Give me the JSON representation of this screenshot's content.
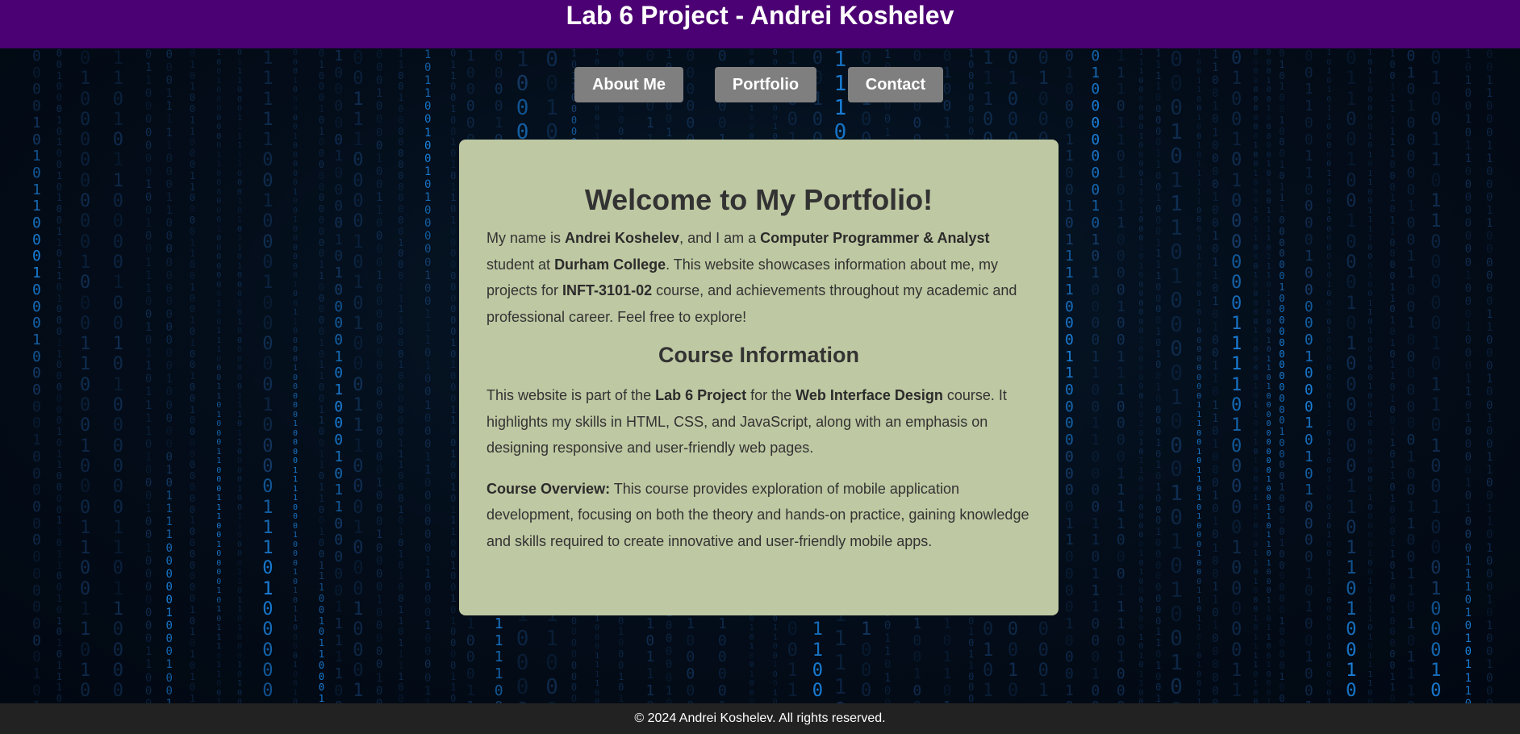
{
  "header": {
    "title": "Lab 6 Project - Andrei Koshelev"
  },
  "nav": {
    "items": [
      {
        "label": "About Me"
      },
      {
        "label": "Portfolio"
      },
      {
        "label": "Contact"
      }
    ]
  },
  "main": {
    "welcome_title": "Welcome to My Portfolio!",
    "intro": {
      "t1": "My name is ",
      "b1": "Andrei Koshelev",
      "t2": ", and I am a ",
      "b2": "Computer Programmer & Analyst",
      "t3": " student at ",
      "b3": "Durham College",
      "t4": ". This website showcases information about me, my projects for ",
      "b4": "INFT-3101-02",
      "t5": " course, and achievements throughout my academic and professional career. Feel free to explore!"
    },
    "course_title": "Course Information",
    "course_info": {
      "t1": "This website is part of the ",
      "b1": "Lab 6 Project",
      "t2": " for the ",
      "b2": "Web Interface Design",
      "t3": " course. It highlights my skills in HTML, CSS, and JavaScript, along with an emphasis on designing responsive and user-friendly web pages."
    },
    "course_overview": {
      "label": "Course Overview:",
      "text": " This course provides exploration of mobile application development, focusing on both the theory and hands-on practice, gaining knowledge and skills required to create innovative and user-friendly mobile apps."
    }
  },
  "footer": {
    "text": "© 2024 Andrei Koshelev. All rights reserved."
  },
  "colors": {
    "header_bg": "#4b0073",
    "nav_button_bg": "#7f7f7f",
    "card_bg": "#bec8a2",
    "footer_bg": "#222222",
    "matrix_digit": "#1e90ff"
  }
}
